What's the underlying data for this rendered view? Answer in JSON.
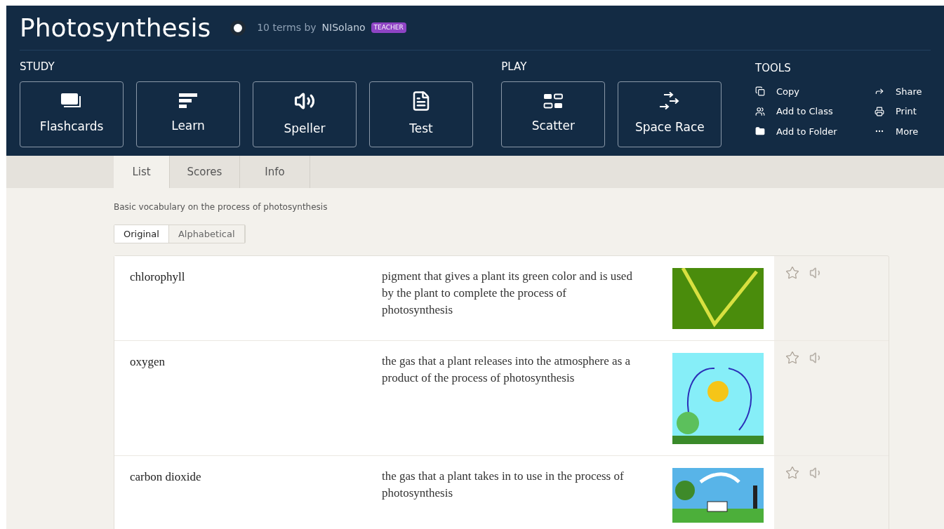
{
  "header": {
    "title": "Photosynthesis",
    "meta": "10 terms by",
    "author": "NISolano",
    "badge": "TEACHER"
  },
  "study": {
    "label": "STUDY",
    "modes": [
      {
        "label": "Flashcards",
        "kind": "flashcards"
      },
      {
        "label": "Learn",
        "kind": "learn"
      },
      {
        "label": "Speller",
        "kind": "speller"
      },
      {
        "label": "Test",
        "kind": "test"
      }
    ]
  },
  "play": {
    "label": "PLAY",
    "modes": [
      {
        "label": "Scatter",
        "kind": "scatter"
      },
      {
        "label": "Space Race",
        "kind": "race"
      }
    ]
  },
  "tools": {
    "label": "TOOLS",
    "items": [
      {
        "label": "Copy",
        "kind": "copy"
      },
      {
        "label": "Share",
        "kind": "share"
      },
      {
        "label": "Add to Class",
        "kind": "class"
      },
      {
        "label": "Print",
        "kind": "print"
      },
      {
        "label": "Add to Folder",
        "kind": "folder"
      },
      {
        "label": "More",
        "kind": "more"
      }
    ]
  },
  "tabs": [
    {
      "label": "List",
      "selected": true
    },
    {
      "label": "Scores",
      "selected": false
    },
    {
      "label": "Info",
      "selected": false
    }
  ],
  "description": "Basic vocabulary on the process of photosynthesis",
  "sort": [
    {
      "label": "Original",
      "selected": true
    },
    {
      "label": "Alphabetical",
      "selected": false
    }
  ],
  "terms": [
    {
      "term": "chlorophyll",
      "definition": "pigment that gives a plant its green color and is used by the plant to complete the process of photosynthesis",
      "kind": "leaf"
    },
    {
      "term": "oxygen",
      "definition": "the gas that a plant releases into the atmosphere as a product of the process of photosynthesis",
      "kind": "oxygen"
    },
    {
      "term": "carbon dioxide",
      "definition": "the gas that a plant takes in to use in the process of photosynthesis",
      "kind": "carbon"
    }
  ]
}
